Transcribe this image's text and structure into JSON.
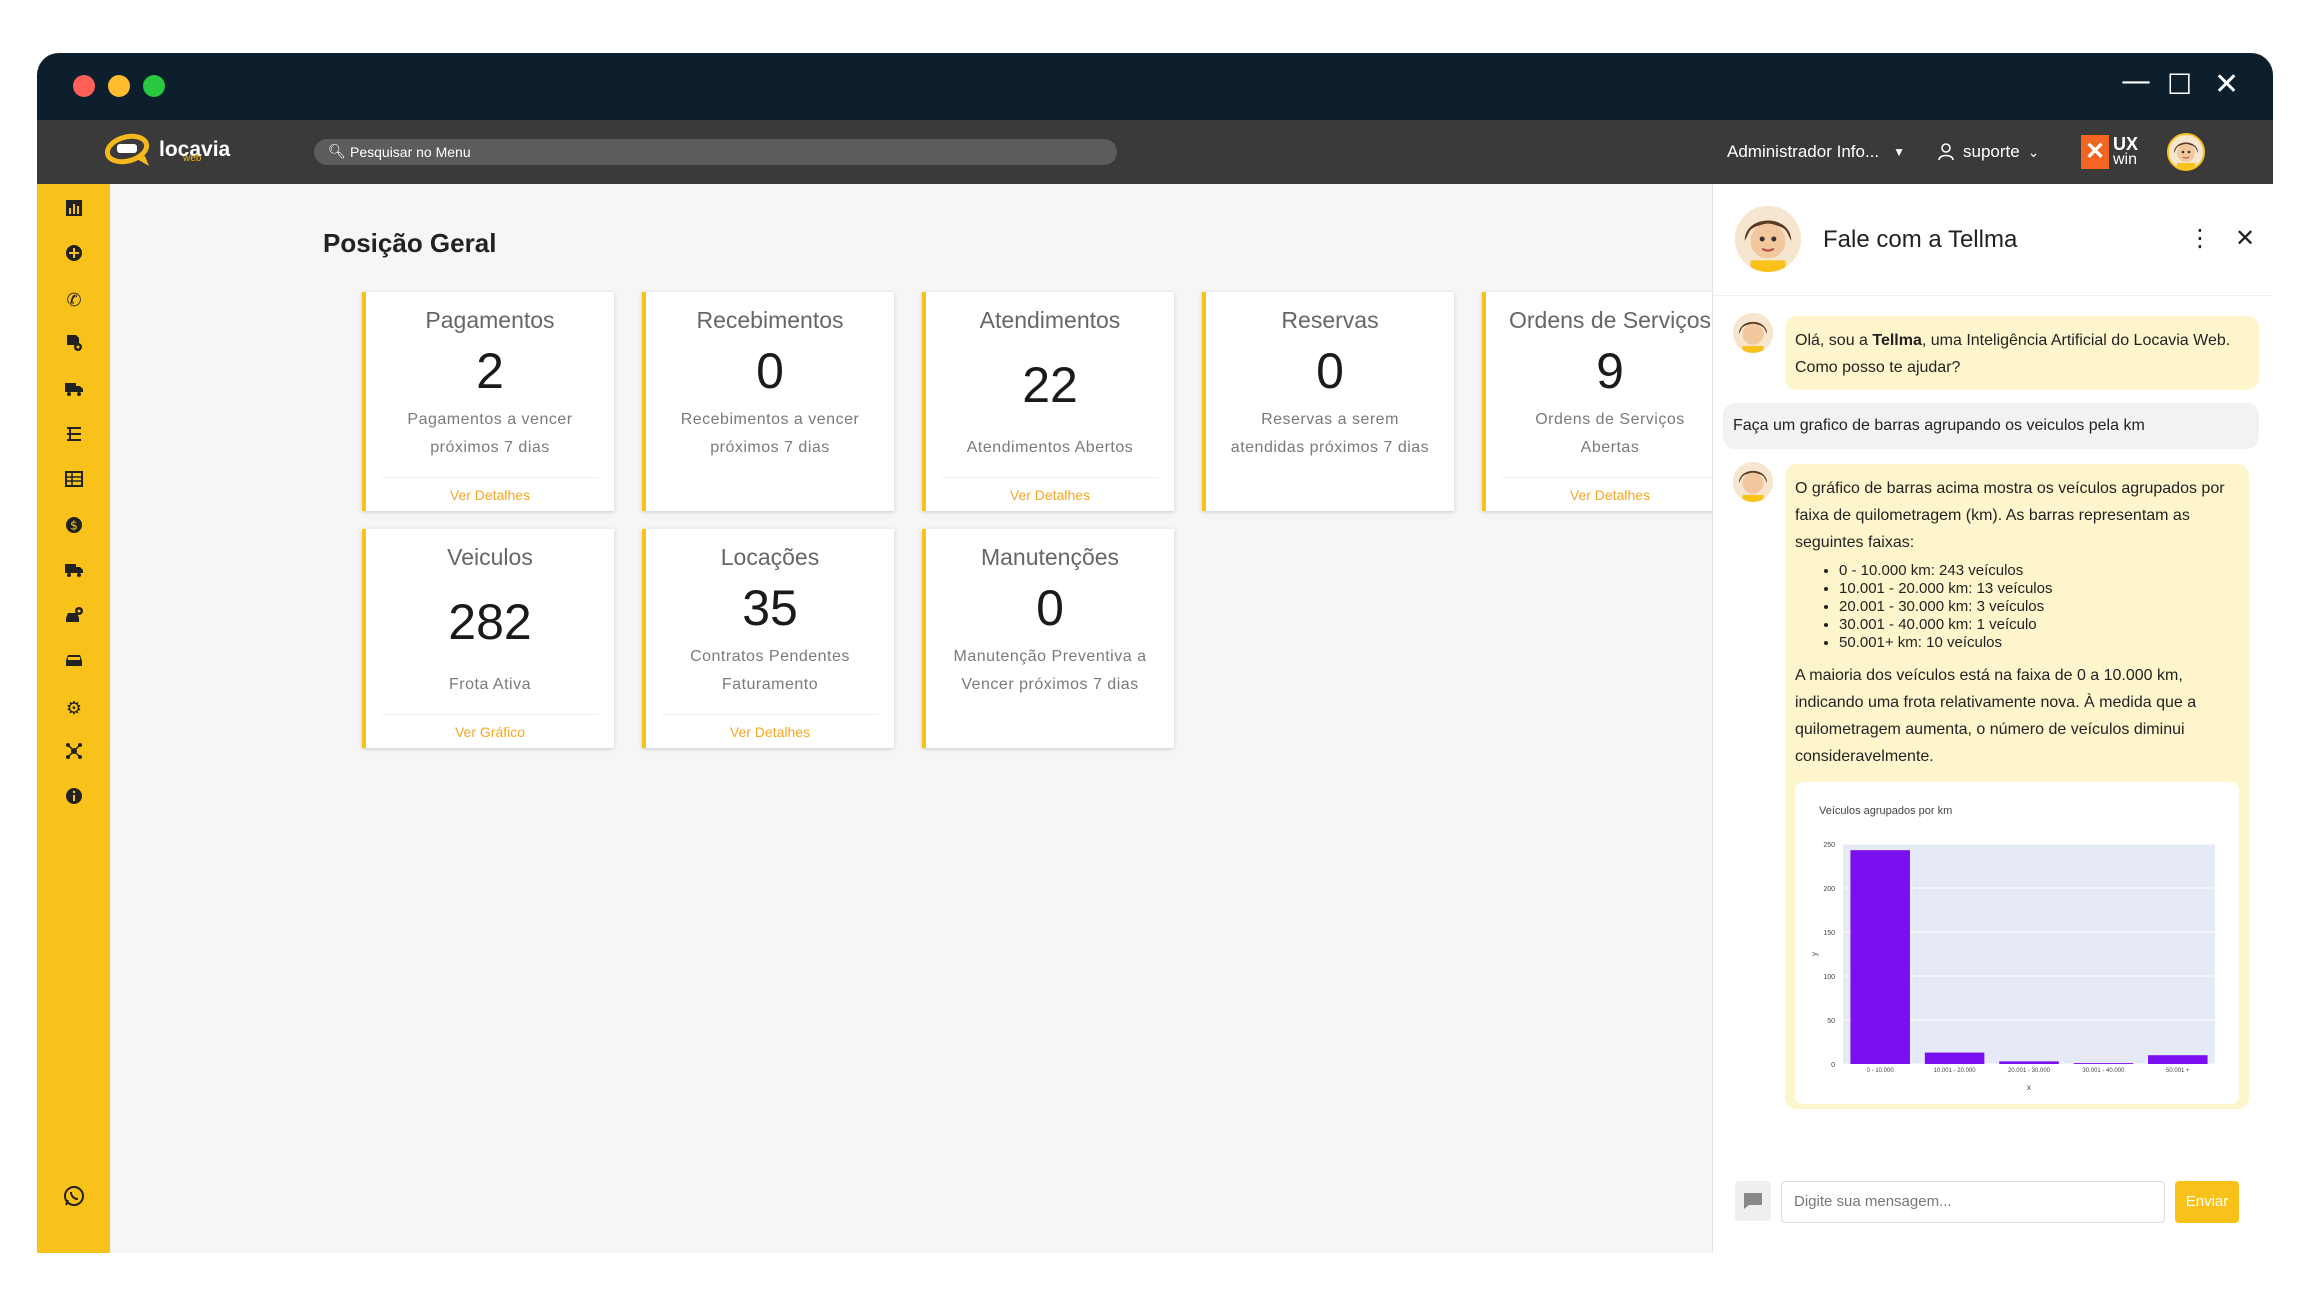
{
  "window": {
    "controls": {
      "minimize": "—",
      "maximize": "☐",
      "close": "✕"
    }
  },
  "header": {
    "logo_text": "locavia",
    "logo_sub": "web",
    "search_placeholder": "Pesquisar no Menu",
    "user_menu": "Administrador Info...",
    "support_menu": "suporte",
    "brand_badge_top": "UX",
    "brand_badge_bottom": "win"
  },
  "sidebar": {
    "items": [
      "chart-icon",
      "plus-circle-icon",
      "phone-icon",
      "document-gear-icon",
      "truck-search-icon",
      "road-icon",
      "table-icon",
      "dollar-icon",
      "truck-icon",
      "car-gear-icon",
      "car-icon",
      "gear-icon",
      "network-icon",
      "info-icon"
    ],
    "bottom": "whatsapp-icon"
  },
  "main": {
    "title": "Posição Geral",
    "cards": [
      {
        "title": "Pagamentos",
        "value": "2",
        "desc1": "Pagamentos a vencer",
        "desc2": "próximos 7 dias",
        "link": "Ver Detalhes"
      },
      {
        "title": "Recebimentos",
        "value": "0",
        "desc1": "Recebimentos a vencer",
        "desc2": "próximos 7 dias",
        "link": ""
      },
      {
        "title": "Atendimentos",
        "value": "22",
        "desc1": "",
        "desc2": "Atendimentos Abertos",
        "link": "Ver Detalhes"
      },
      {
        "title": "Reservas",
        "value": "0",
        "desc1": "Reservas a serem",
        "desc2": "atendidas próximos 7 dias",
        "link": ""
      },
      {
        "title": "Ordens de Serviços",
        "value": "9",
        "desc1": "Ordens de Serviços",
        "desc2": "Abertas",
        "link": "Ver Detalhes"
      },
      {
        "title": "Veiculos",
        "value": "282",
        "desc1": "",
        "desc2": "Frota Ativa",
        "link": "Ver Gráfico"
      },
      {
        "title": "Locações",
        "value": "35",
        "desc1": "Contratos Pendentes",
        "desc2": "Faturamento",
        "link": "Ver Detalhes"
      },
      {
        "title": "Manutenções",
        "value": "0",
        "desc1": "Manutenção Preventiva a",
        "desc2": "Vencer próximos 7 dias",
        "link": ""
      }
    ]
  },
  "chat": {
    "title": "Fale com a Tellma",
    "greeting_pre": "Olá, sou a ",
    "greeting_name": "Tellma",
    "greeting_post": ", uma Inteligência Artificial do Locavia Web. Como posso te ajudar?",
    "user_message": "Faça um grafico de barras agrupando os veiculos pela km",
    "answer_intro": "O gráfico de barras acima mostra os veículos agrupados por faixa de quilometragem (km). As barras representam as seguintes faixas:",
    "answer_list": [
      "0 - 10.000 km: 243 veículos",
      "10.001 - 20.000 km: 13 veículos",
      "20.001 - 30.000 km: 3 veículos",
      "30.001 - 40.000 km: 1 veículo",
      "50.001+ km: 10 veículos"
    ],
    "answer_outro": "A maioria dos veículos está na faixa de 0 a 10.000 km, indicando uma frota relativamente nova. À medida que a quilometragem aumenta, o número de veículos diminui consideravelmente.",
    "input_placeholder": "Digite sua mensagem...",
    "send_label": "Enviar"
  },
  "chart_data": {
    "type": "bar",
    "title": "Veículos agrupados por km",
    "xlabel": "x",
    "ylabel": "y",
    "categories": [
      "0 - 10.000",
      "10.001 - 20.000",
      "20.001 - 30.000",
      "30.001 - 40.000",
      "50.001 +"
    ],
    "values": [
      243,
      13,
      3,
      1,
      10
    ],
    "ylim": [
      0,
      250
    ],
    "yticks": [
      "0",
      "50",
      "100",
      "150",
      "200",
      "250"
    ],
    "bar_color": "#7a0ff0",
    "plot_bg": "#e6eaf6"
  }
}
